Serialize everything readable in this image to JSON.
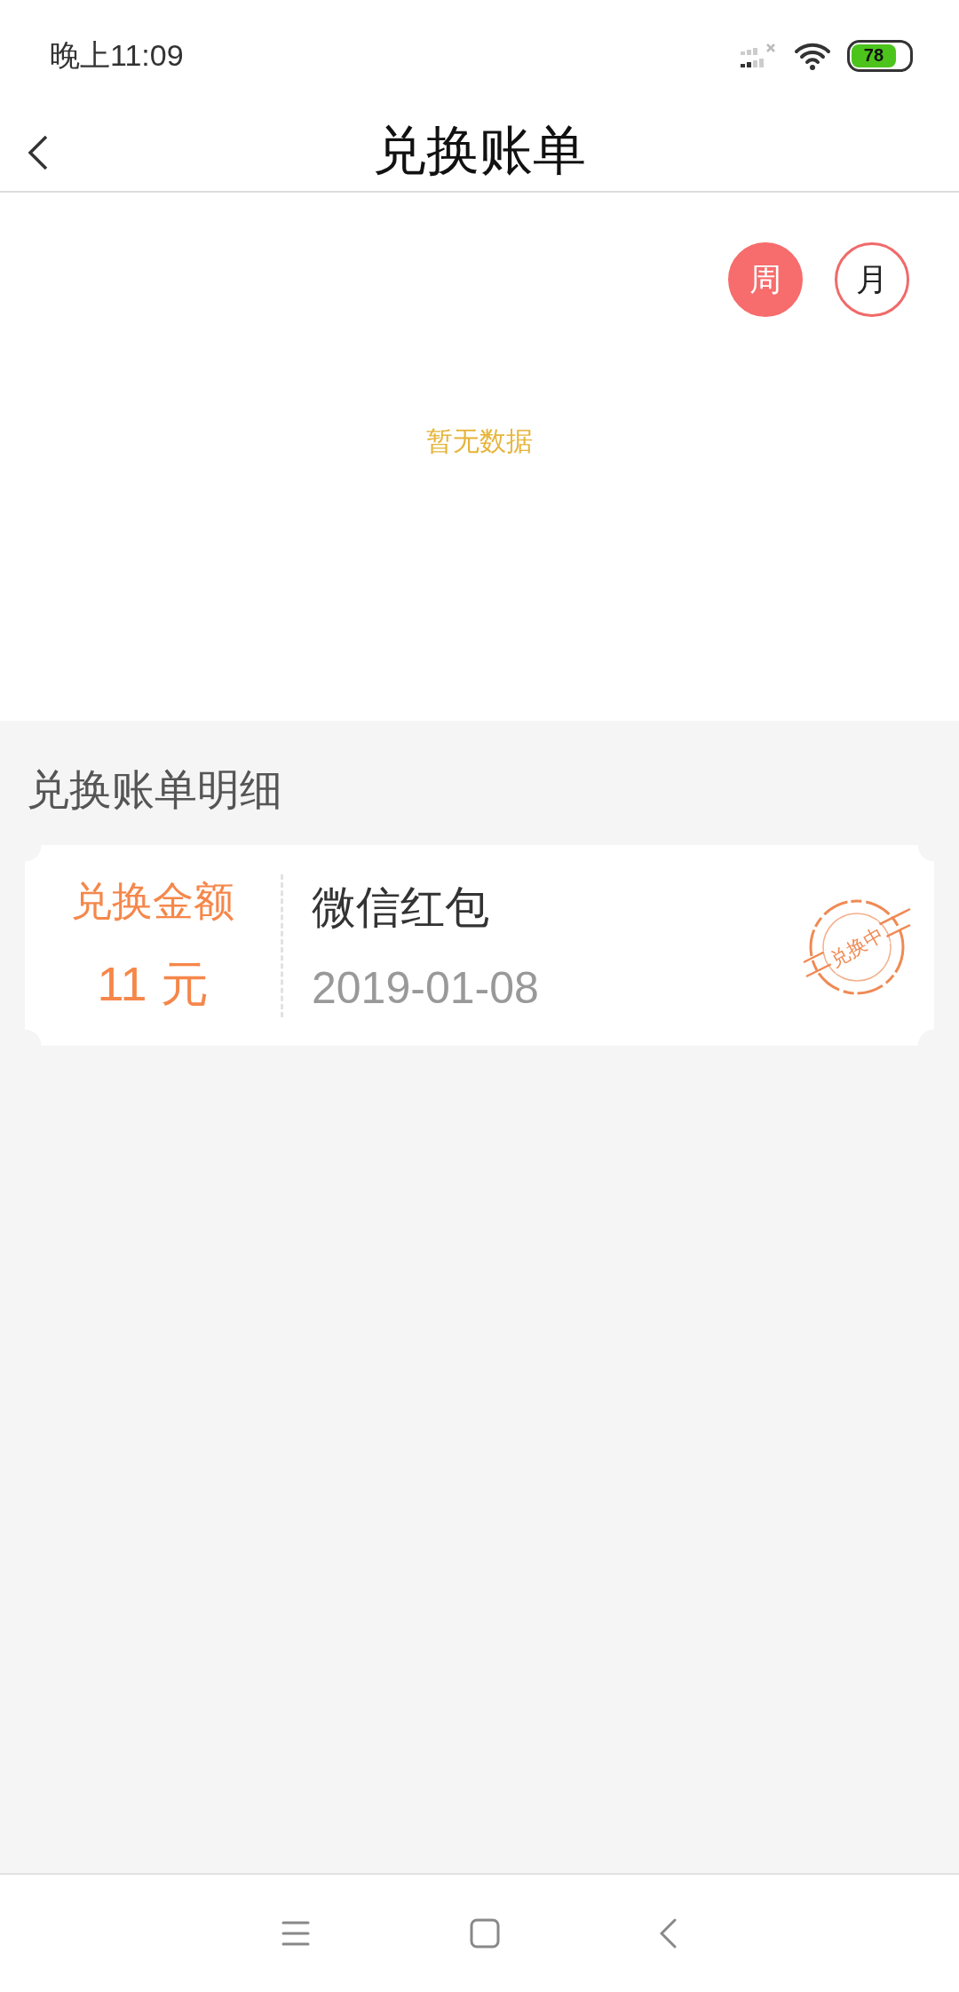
{
  "status_bar": {
    "time": "晚上11:09",
    "battery": "78"
  },
  "header": {
    "title": "兑换账单"
  },
  "period_toggle": [
    {
      "label": "周",
      "selected": true
    },
    {
      "label": "月",
      "selected": false
    }
  ],
  "chart": {
    "empty_text": "暂无数据"
  },
  "details": {
    "title": "兑换账单明细",
    "records": [
      {
        "amount_label": "兑换金额",
        "amount": "11 元",
        "name": "微信红包",
        "date": "2019-01-08",
        "stamp": "兑换中"
      }
    ]
  }
}
